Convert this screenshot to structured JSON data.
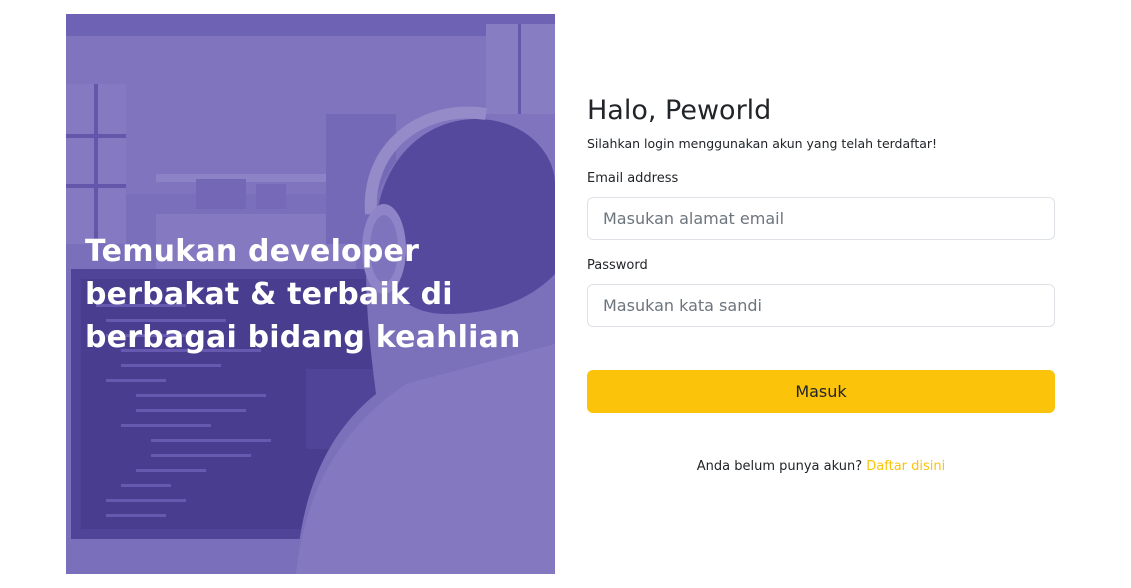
{
  "hero": {
    "title": "Temukan developer berbakat & terbaik di berbagai bidang keahlian",
    "image_description_icon": "developer-photo"
  },
  "form": {
    "greeting": "Halo, Peworld",
    "subtitle": "Silahkan login menggunakan akun yang telah terdaftar!",
    "email": {
      "label": "Email address",
      "placeholder": "Masukan alamat email",
      "value": ""
    },
    "password": {
      "label": "Password",
      "placeholder": "Masukan kata sandi",
      "value": ""
    },
    "submit_label": "Masuk",
    "register_prompt": "Anda belum punya akun?",
    "register_link": "Daftar disini"
  },
  "colors": {
    "accent": "#fbc30a",
    "hero_overlay": "#5e50aa",
    "text": "#212529",
    "border": "#dee2e6"
  }
}
